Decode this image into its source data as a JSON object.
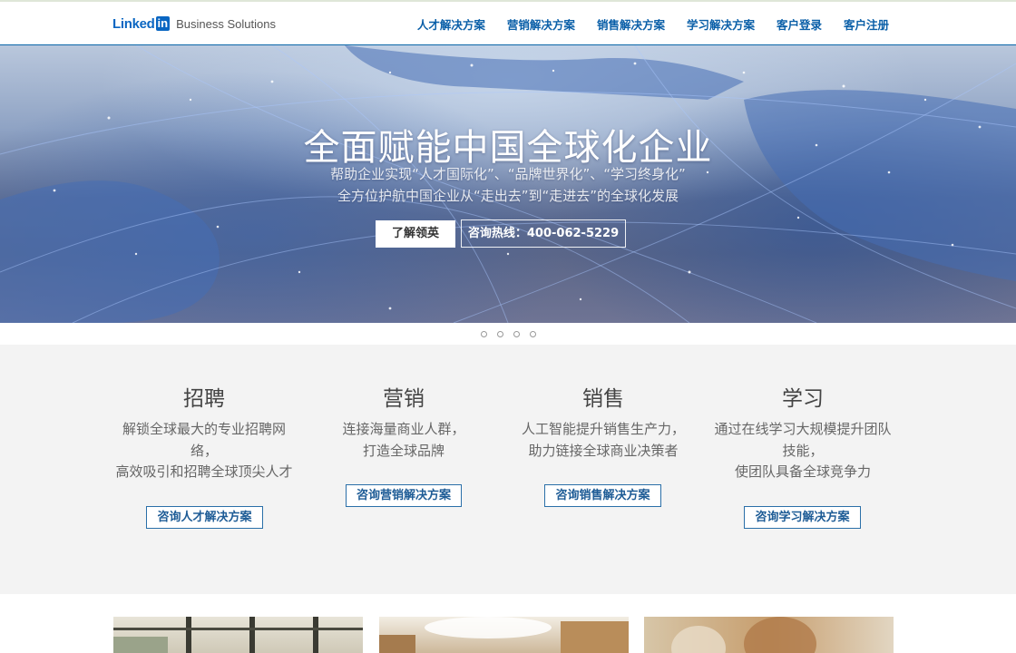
{
  "header": {
    "logo_word": "Linked",
    "logo_in": "in",
    "logo_sub": "Business Solutions",
    "nav": [
      "人才解决方案",
      "营销解决方案",
      "销售解决方案",
      "学习解决方案",
      "客户登录",
      "客户注册"
    ]
  },
  "hero": {
    "title": "全面赋能中国全球化企业",
    "subtitle_line1": "帮助企业实现“人才国际化”、“品牌世界化”、“学习终身化”",
    "subtitle_line2": "全方位护航中国企业从“走出去”到“走进去”的全球化发展",
    "learn_button": "了解领英",
    "hotline_button": "咨询热线：400-062-5229"
  },
  "carousel": {
    "slide_count": 4
  },
  "solutions": [
    {
      "title": "招聘",
      "desc": [
        "解锁全球最大的专业招聘网",
        "络，",
        "高效吸引和招聘全球顶尖人才"
      ],
      "button": "咨询人才解决方案"
    },
    {
      "title": "营销",
      "desc": [
        "连接海量商业人群，",
        "打造全球品牌"
      ],
      "button": "咨询营销解决方案"
    },
    {
      "title": "销售",
      "desc": [
        "人工智能提升销售生产力，",
        "助力链接全球商业决策者"
      ],
      "button": "咨询销售解决方案"
    },
    {
      "title": "学习",
      "desc": [
        "通过在线学习大规模提升团队",
        "技能，",
        "使团队具备全球竞争力"
      ],
      "button": "咨询学习解决方案"
    }
  ],
  "colors": {
    "brand": "#0a66c2",
    "nav": "#0a5fa8",
    "section_bg": "#f3f3f3"
  }
}
